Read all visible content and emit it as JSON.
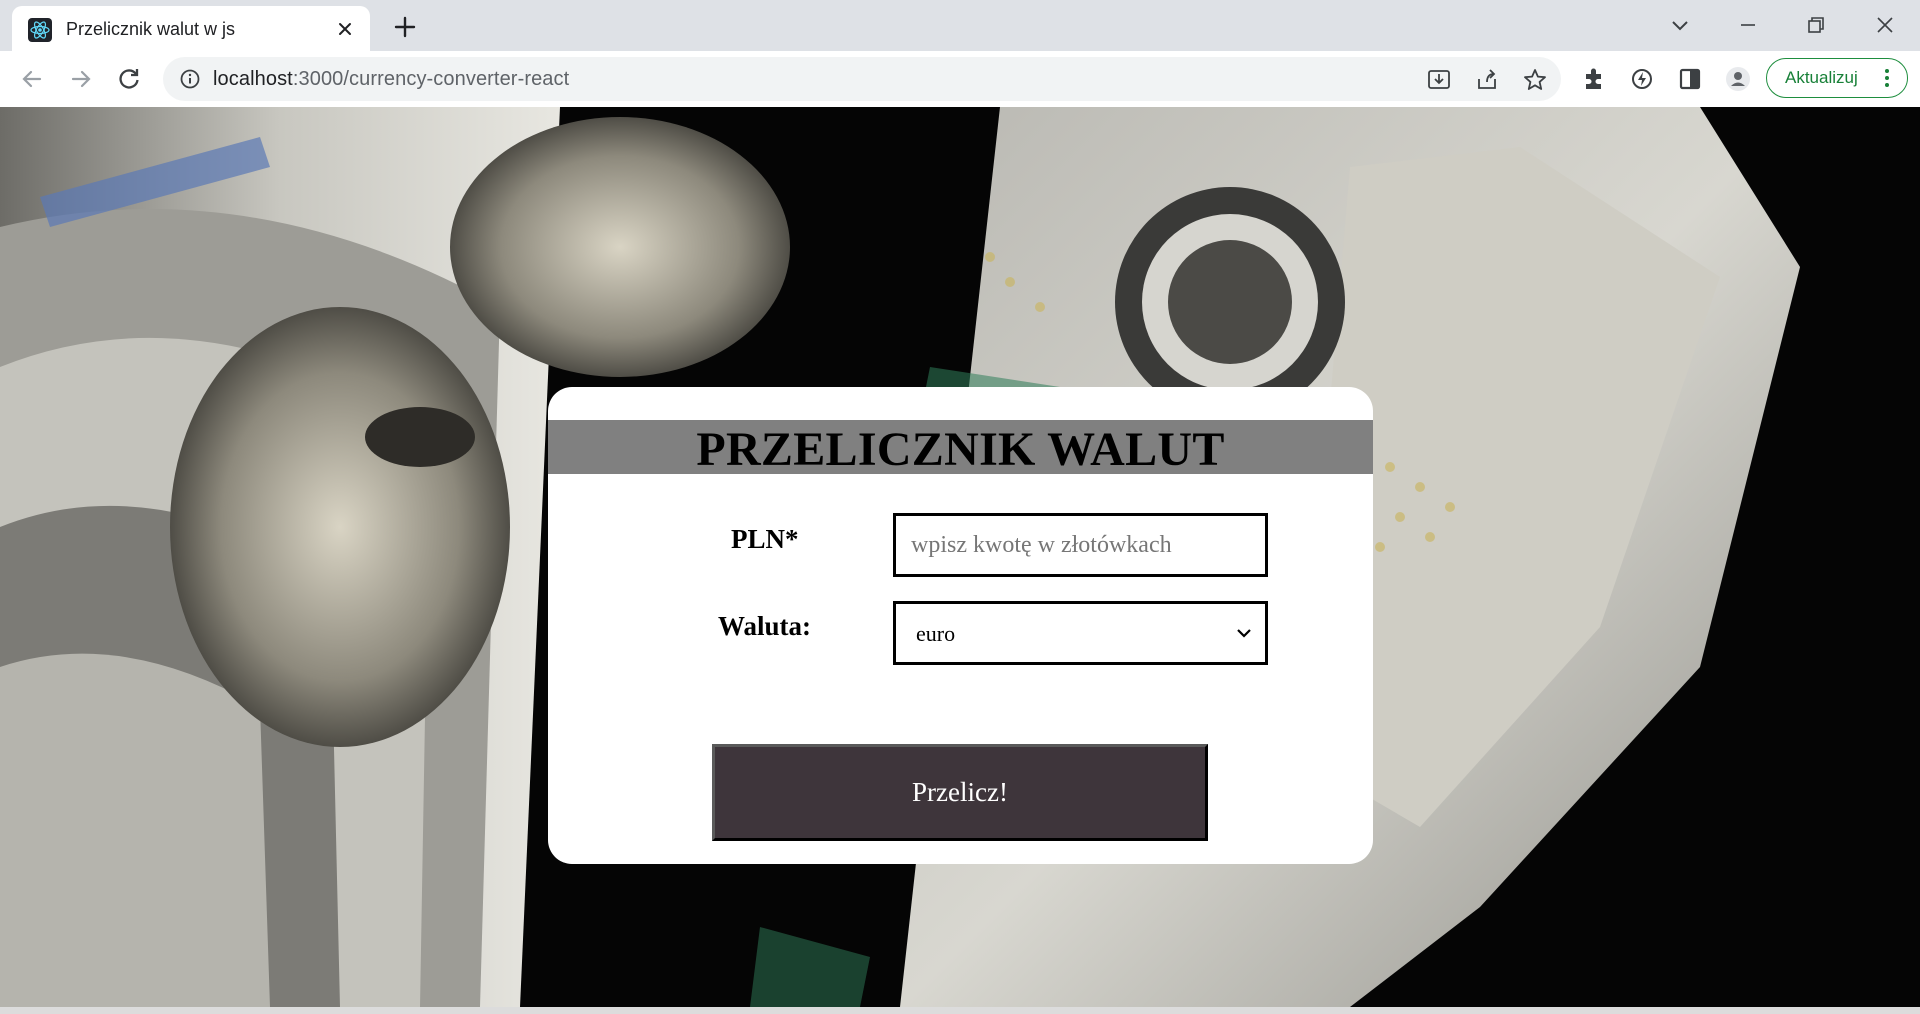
{
  "browser": {
    "tab_title": "Przelicznik walut w js",
    "url_host": "localhost",
    "url_rest": ":3000/currency-converter-react",
    "update_label": "Aktualizuj"
  },
  "converter": {
    "title": "PRZELICZNIK WALUT",
    "amount_label": "PLN*",
    "amount_placeholder": "wpisz kwotę w złotówkach",
    "amount_value": "",
    "currency_label": "Waluta:",
    "currency_selected": "euro",
    "button_label": "Przelicz!"
  },
  "colors": {
    "header_bar": "#808080",
    "button_bg": "#3e353b",
    "update_accent": "#188038"
  }
}
